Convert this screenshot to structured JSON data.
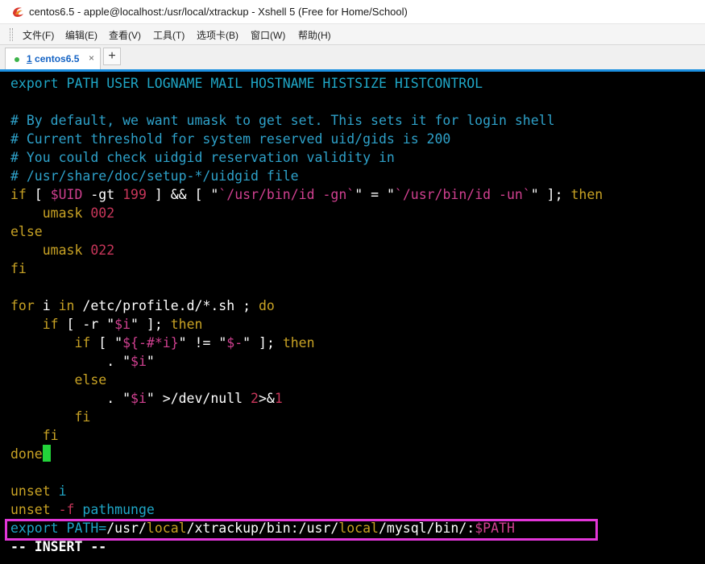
{
  "window": {
    "title": "centos6.5 - apple@localhost:/usr/local/xtrackup - Xshell 5 (Free for Home/School)"
  },
  "menu": [
    "文件(F)",
    "编辑(E)",
    "查看(V)",
    "工具(T)",
    "选项卡(B)",
    "窗口(W)",
    "帮助(H)"
  ],
  "tabs": [
    {
      "number": "1",
      "name": " centos6.5",
      "close": "×",
      "status_color": "#3cb34a"
    }
  ],
  "new_tab_label": "+",
  "colors": {
    "accent": "#1a8fe0",
    "highlight_box": "#e236d8",
    "cursor": "#22d33a"
  },
  "terminal": {
    "lines": [
      [
        [
          "c",
          "export PATH USER LOGNAME MAIL HOSTNAME HISTSIZE HISTCONTROL"
        ]
      ],
      [],
      [
        [
          "cm",
          "# By default, we want umask to get set. This sets it for login shell"
        ]
      ],
      [
        [
          "cm",
          "# Current threshold for system reserved uid/gids is 200"
        ]
      ],
      [
        [
          "cm",
          "# You could check uidgid reservation validity in"
        ]
      ],
      [
        [
          "cm",
          "# /usr/share/doc/setup-*/uidgid file"
        ]
      ],
      [
        [
          "k",
          "if"
        ],
        [
          "w",
          " [ "
        ],
        [
          "s",
          "$UID"
        ],
        [
          "w",
          " -gt "
        ],
        [
          "n",
          "199"
        ],
        [
          "w",
          " ] && [ \""
        ],
        [
          "s",
          "`/usr/bin/id -gn`"
        ],
        [
          "w",
          "\" = \""
        ],
        [
          "s",
          "`/usr/bin/id -un`"
        ],
        [
          "w",
          "\" ]; "
        ],
        [
          "k",
          "then"
        ]
      ],
      [
        [
          "w",
          "    "
        ],
        [
          "k",
          "umask"
        ],
        [
          "w",
          " "
        ],
        [
          "n",
          "002"
        ]
      ],
      [
        [
          "k",
          "else"
        ]
      ],
      [
        [
          "w",
          "    "
        ],
        [
          "k",
          "umask"
        ],
        [
          "w",
          " "
        ],
        [
          "n",
          "022"
        ]
      ],
      [
        [
          "k",
          "fi"
        ]
      ],
      [],
      [
        [
          "k",
          "for"
        ],
        [
          "w",
          " i "
        ],
        [
          "k",
          "in"
        ],
        [
          "w",
          " /etc/profile.d/*.sh ; "
        ],
        [
          "k",
          "do"
        ]
      ],
      [
        [
          "w",
          "    "
        ],
        [
          "k",
          "if"
        ],
        [
          "w",
          " [ -r \""
        ],
        [
          "s",
          "$i"
        ],
        [
          "w",
          "\" ]; "
        ],
        [
          "k",
          "then"
        ]
      ],
      [
        [
          "w",
          "        "
        ],
        [
          "k",
          "if"
        ],
        [
          "w",
          " [ \""
        ],
        [
          "s",
          "${-#*i}"
        ],
        [
          "w",
          "\" != \""
        ],
        [
          "s",
          "$-"
        ],
        [
          "w",
          "\" ]; "
        ],
        [
          "k",
          "then"
        ]
      ],
      [
        [
          "w",
          "            . \""
        ],
        [
          "s",
          "$i"
        ],
        [
          "w",
          "\""
        ]
      ],
      [
        [
          "w",
          "        "
        ],
        [
          "k",
          "else"
        ]
      ],
      [
        [
          "w",
          "            . \""
        ],
        [
          "s",
          "$i"
        ],
        [
          "w",
          "\" >/dev/null "
        ],
        [
          "n",
          "2"
        ],
        [
          "w",
          ">&"
        ],
        [
          "n",
          "1"
        ]
      ],
      [
        [
          "w",
          "        "
        ],
        [
          "k",
          "fi"
        ]
      ],
      [
        [
          "w",
          "    "
        ],
        [
          "k",
          "fi"
        ]
      ],
      [
        [
          "k",
          "done"
        ],
        [
          "cursor",
          ""
        ]
      ],
      [],
      [
        [
          "k",
          "unset"
        ],
        [
          "w",
          " "
        ],
        [
          "c",
          "i"
        ]
      ],
      [
        [
          "k",
          "unset"
        ],
        [
          "w",
          " "
        ],
        [
          "n",
          "-f"
        ],
        [
          "w",
          " "
        ],
        [
          "c",
          "pathmunge"
        ]
      ],
      [
        [
          "c",
          "export PATH="
        ],
        [
          "w",
          "/usr/"
        ],
        [
          "k",
          "local"
        ],
        [
          "w",
          "/xtrackup/bin:/usr/"
        ],
        [
          "k",
          "local"
        ],
        [
          "w",
          "/mysql/bin/:"
        ],
        [
          "s",
          "$PATH"
        ]
      ],
      [
        [
          "mode",
          "-- INSERT --"
        ]
      ]
    ]
  }
}
